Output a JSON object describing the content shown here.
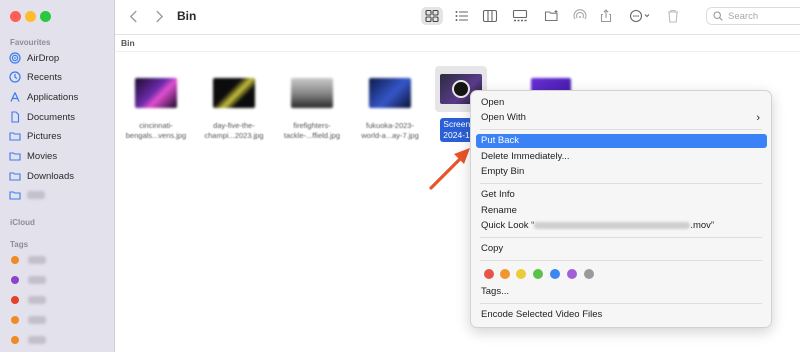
{
  "window": {
    "title": "Bin"
  },
  "sidebar": {
    "sections": {
      "favourites": "Favourites",
      "icloud": "iCloud",
      "tags": "Tags"
    },
    "items": [
      {
        "label": "AirDrop",
        "icon": "airdrop-icon"
      },
      {
        "label": "Recents",
        "icon": "clock-icon"
      },
      {
        "label": "Applications",
        "icon": "applications-icon"
      },
      {
        "label": "Documents",
        "icon": "document-icon"
      },
      {
        "label": "Pictures",
        "icon": "folder-icon"
      },
      {
        "label": "Movies",
        "icon": "folder-icon"
      },
      {
        "label": "Downloads",
        "icon": "folder-icon"
      }
    ],
    "tag_colors": [
      "#f08a24",
      "#8b44c9",
      "#e5402b",
      "#f08a24",
      "#f08a24"
    ]
  },
  "toolbar": {
    "search_placeholder": "Search",
    "icons": [
      "back-icon",
      "forward-icon",
      "icon-view-icon",
      "list-view-icon",
      "column-view-icon",
      "gallery-view-icon",
      "new-folder-icon",
      "airdrop-icon",
      "share-icon",
      "more-icon",
      "trash-icon"
    ]
  },
  "pathbar": {
    "label": "Bin"
  },
  "files": [
    {
      "name_line1": "cincinnati-",
      "name_line2": "bengals...vens.jpg"
    },
    {
      "name_line1": "day-five-the-",
      "name_line2": "champi...2023.jpg"
    },
    {
      "name_line1": "firefighters-",
      "name_line2": "tackle-...ffield.jpg"
    },
    {
      "name_line1": "fukuoka-2023-",
      "name_line2": "world-a...ay-7.jpg"
    }
  ],
  "selected_file": {
    "name_line1": "Screen R",
    "name_line2": "2024-1..."
  },
  "context_menu": {
    "open": "Open",
    "open_with": "Open With",
    "put_back": "Put Back",
    "delete_immediately": "Delete Immediately...",
    "empty_bin": "Empty Bin",
    "get_info": "Get Info",
    "rename": "Rename",
    "quick_look_prefix": "Quick Look “",
    "quick_look_suffix": ".mov”",
    "copy": "Copy",
    "tags": "Tags...",
    "encode": "Encode Selected Video Files",
    "tag_colors": [
      "#e5554a",
      "#f0962e",
      "#eccb3b",
      "#5cc04a",
      "#3c86f0",
      "#a35fd6",
      "#9a9a9a"
    ]
  },
  "colors": {
    "accent": "#3b82f6",
    "selection": "#2a5fd6",
    "annotation_arrow": "#e8542a"
  }
}
